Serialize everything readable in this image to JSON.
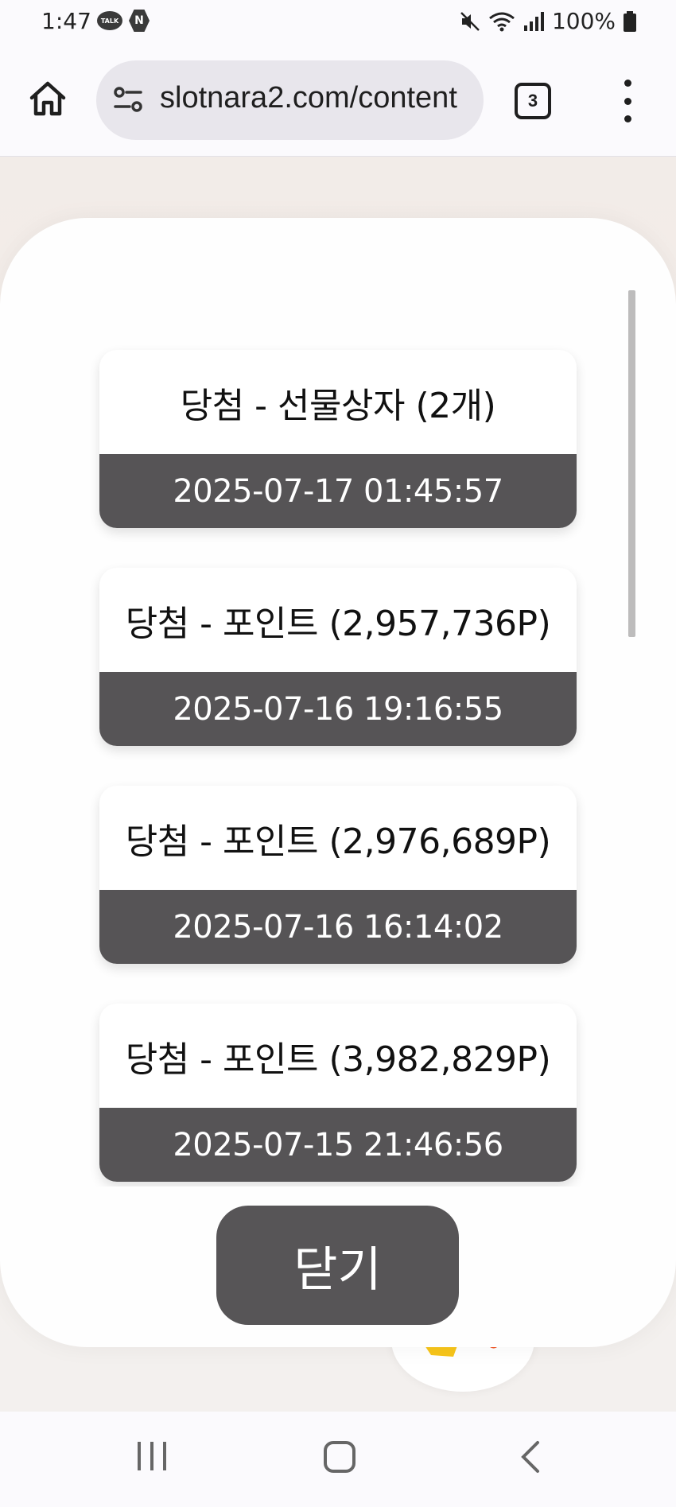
{
  "status_bar": {
    "time": "1:47",
    "talk_badge": "TALK",
    "n_badge": "N",
    "battery": "100%",
    "icons": [
      "mute-icon",
      "wifi-icon",
      "signal-icon",
      "battery-icon"
    ]
  },
  "browser": {
    "url": "slotnara2.com/content",
    "tab_count": "3",
    "icons": [
      "home-icon",
      "site-settings-icon",
      "tabs-icon",
      "more-menu-icon"
    ]
  },
  "modal": {
    "items": [
      {
        "title": "당첨 - 선물상자 (2개)",
        "date": "2025-07-17 01:45:57"
      },
      {
        "title": "당첨 - 포인트 (2,957,736P)",
        "date": "2025-07-16 19:16:55"
      },
      {
        "title": "당첨 - 포인트 (2,976,689P)",
        "date": "2025-07-16 16:14:02"
      },
      {
        "title": "당첨 - 포인트 (3,982,829P)",
        "date": "2025-07-15 21:46:56"
      }
    ],
    "close_label": "닫기"
  },
  "colors": {
    "card_footer": "#565456",
    "close_button": "#575557",
    "modal_bg": "#fefefe"
  },
  "nav_bar": {
    "icons": [
      "recent-apps-icon",
      "home-nav-icon",
      "back-icon"
    ]
  }
}
